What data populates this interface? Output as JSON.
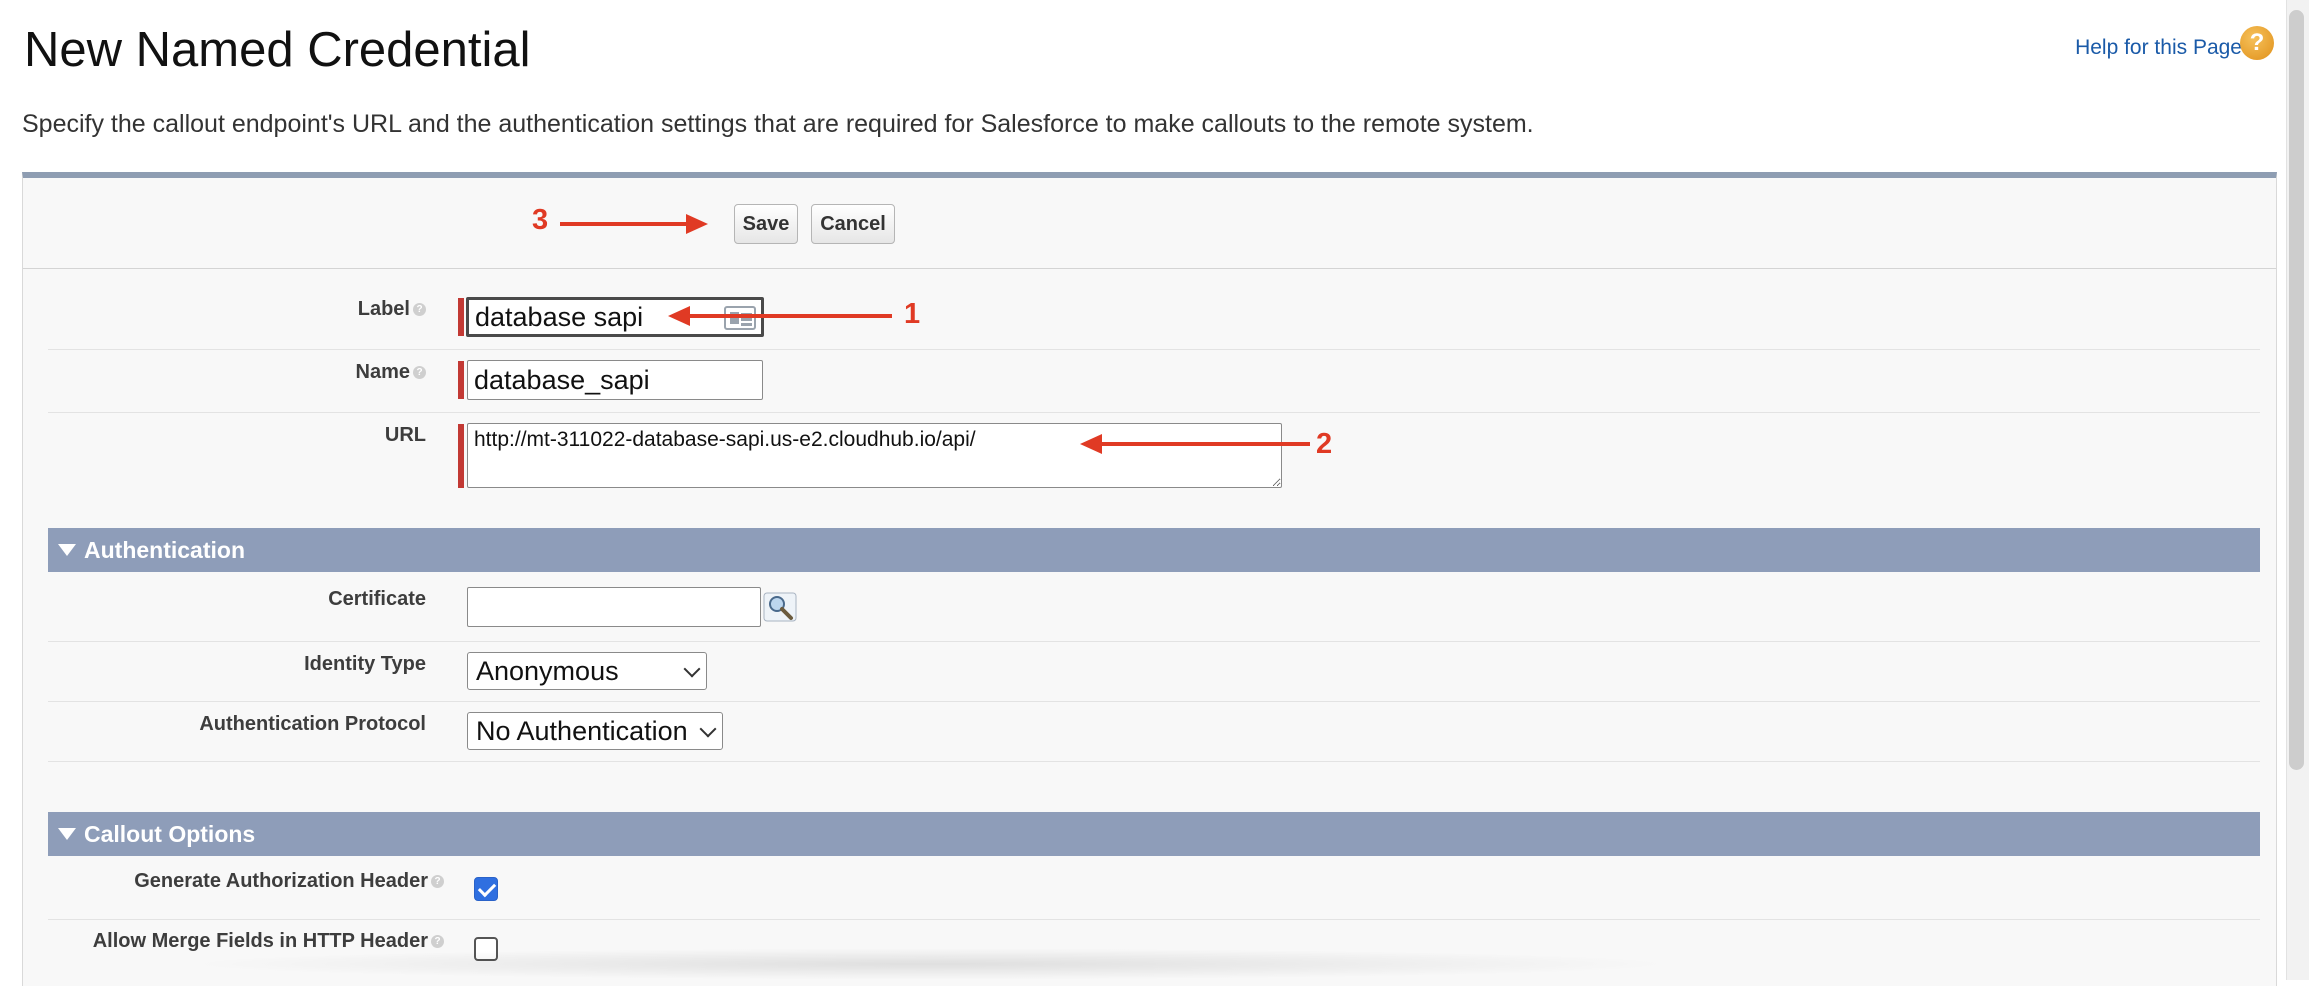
{
  "page": {
    "title": "New Named Credential",
    "help_link": "Help for this Page",
    "help_icon": "question-mark-icon",
    "description": "Specify the callout endpoint's URL and the authentication settings that are required for Salesforce to make callouts to the remote system."
  },
  "toolbar": {
    "save_label": "Save",
    "cancel_label": "Cancel"
  },
  "annotations": {
    "step1": "1",
    "step2": "2",
    "step3": "3",
    "color": "#e03a24"
  },
  "form": {
    "label": {
      "label": "Label",
      "value": "database sapi"
    },
    "name": {
      "label": "Name",
      "value": "database_sapi"
    },
    "url": {
      "label": "URL",
      "value": "http://mt-311022-database-sapi.us-e2.cloudhub.io/api/"
    }
  },
  "authentication": {
    "title": "Authentication",
    "certificate": {
      "label": "Certificate",
      "value": ""
    },
    "identity_type": {
      "label": "Identity Type",
      "value": "Anonymous"
    },
    "auth_protocol": {
      "label": "Authentication Protocol",
      "value": "No Authentication"
    }
  },
  "callout_options": {
    "title": "Callout Options",
    "generate_auth_header": {
      "label": "Generate Authorization Header",
      "checked": true
    },
    "allow_merge_fields": {
      "label": "Allow Merge Fields in HTTP Header",
      "checked": false
    }
  },
  "colors": {
    "required": "#c23934",
    "section_header": "#8e9db9",
    "link": "#1a5aa8",
    "checkbox": "#2f6fe0"
  }
}
